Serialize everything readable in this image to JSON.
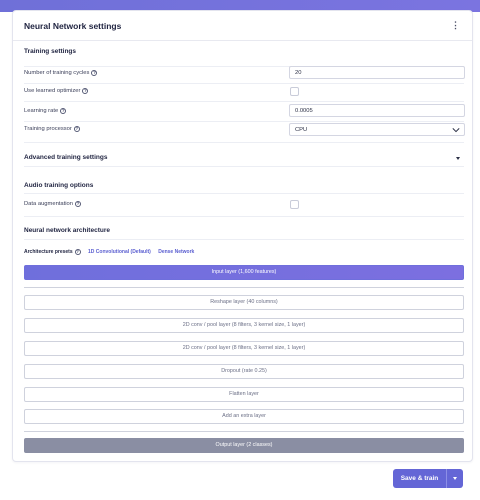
{
  "card": {
    "title": "Neural Network settings",
    "menu_glyph": "⋮"
  },
  "training": {
    "title": "Training settings",
    "cycles_label": "Number of training cycles",
    "cycles_value": "20",
    "learned_optimizer_label": "Use learned optimizer",
    "learned_optimizer_checked": false,
    "learning_rate_label": "Learning rate",
    "learning_rate_value": "0.0005",
    "processor_label": "Training processor",
    "processor_value": "CPU"
  },
  "advanced": {
    "title": "Advanced training settings"
  },
  "audio": {
    "title": "Audio training options",
    "augmentation_label": "Data augmentation",
    "augmentation_checked": false
  },
  "architecture": {
    "title": "Neural network architecture",
    "presets_label": "Architecture presets",
    "preset_options": [
      "1D Convolutional (Default)",
      "Dense Network"
    ],
    "input_layer": "Input layer (1,600 features)",
    "layers": [
      "Reshape layer (40 columns)",
      "2D conv / pool layer (8 filters, 3 kernel size, 1 layer)",
      "2D conv / pool layer (8 filters, 3 kernel size, 1 layer)",
      "Dropout (rate 0.25)",
      "Flatten layer"
    ],
    "add_layer": "Add an extra layer",
    "output_layer": "Output layer (2 classes)"
  },
  "footer": {
    "save_label": "Save & train"
  },
  "icons": {
    "help": "?"
  },
  "colors": {
    "accent": "#6466d6",
    "output_layer": "#8a8ea3",
    "link": "#5a5ed0"
  }
}
